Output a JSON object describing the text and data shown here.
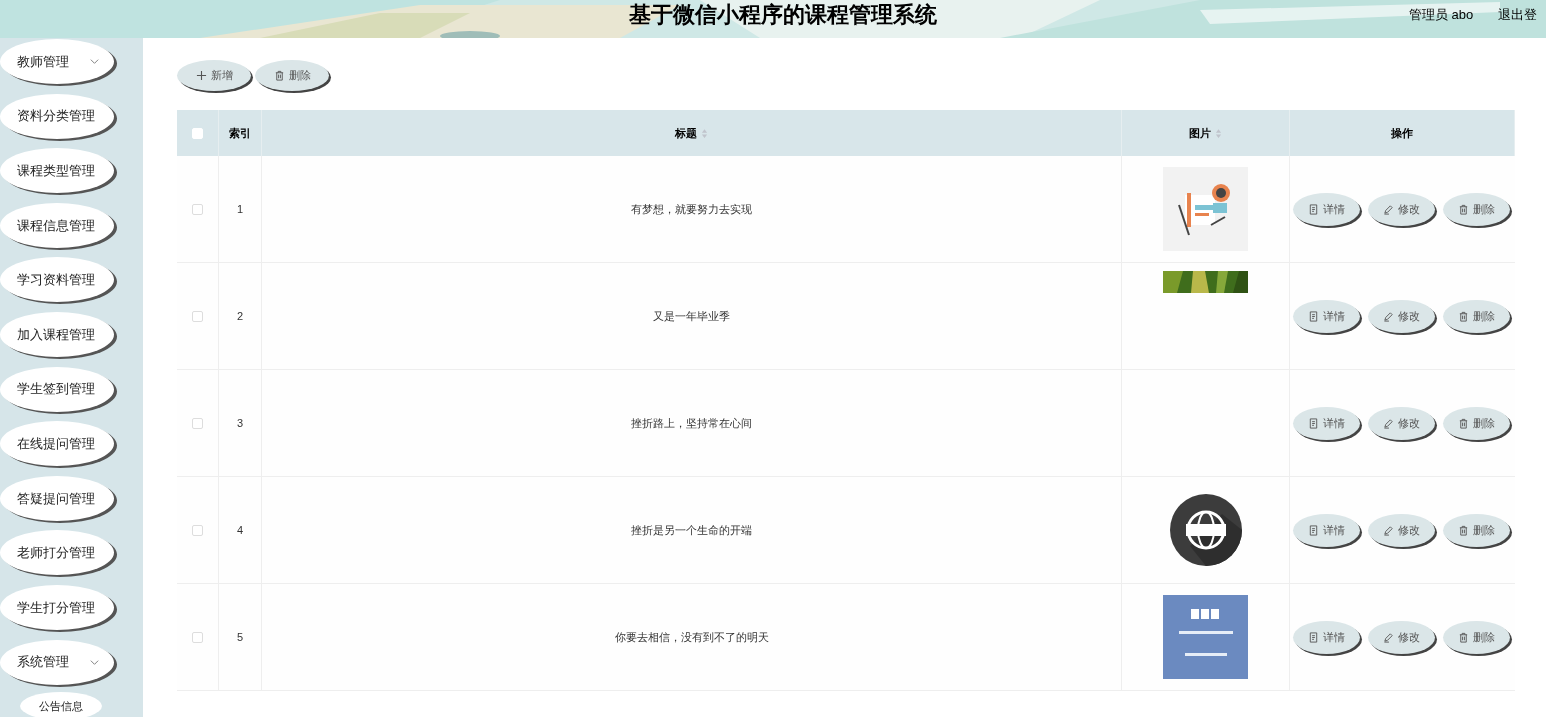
{
  "header": {
    "title": "基于微信小程序的课程管理系统",
    "user": "管理员 abo",
    "logout": "退出登"
  },
  "sidebar": {
    "items": [
      {
        "label": "教师管理",
        "kind": "group"
      },
      {
        "label": "资料分类管理",
        "kind": "link"
      },
      {
        "label": "课程类型管理",
        "kind": "link"
      },
      {
        "label": "课程信息管理",
        "kind": "link"
      },
      {
        "label": "学习资料管理",
        "kind": "link"
      },
      {
        "label": "加入课程管理",
        "kind": "link"
      },
      {
        "label": "学生签到管理",
        "kind": "link"
      },
      {
        "label": "在线提问管理",
        "kind": "link"
      },
      {
        "label": "答疑提问管理",
        "kind": "link"
      },
      {
        "label": "老师打分管理",
        "kind": "link"
      },
      {
        "label": "学生打分管理",
        "kind": "link"
      },
      {
        "label": "系统管理",
        "kind": "group",
        "children": [
          {
            "label": "公告信息"
          }
        ]
      }
    ]
  },
  "toolbar": [
    {
      "label": "新增",
      "kind": "add"
    },
    {
      "label": "删除",
      "kind": "delete"
    }
  ],
  "table": {
    "header_checkbox": {
      "checked": false
    },
    "columns": [
      {
        "label": "索引",
        "sortable": false
      },
      {
        "label": "标题",
        "sortable": true
      },
      {
        "label": "图片",
        "sortable": true
      },
      {
        "label": "操作",
        "sortable": false
      }
    ],
    "rows": [
      {
        "checked": false,
        "index": "1",
        "title": "有梦想，就要努力去实现",
        "image": {
          "kind": "picture"
        },
        "actions": [
          {
            "label": "详情",
            "kind": "detail"
          },
          {
            "label": "修改",
            "kind": "edit"
          },
          {
            "label": "删除",
            "kind": "delete"
          }
        ]
      },
      {
        "checked": false,
        "index": "2",
        "title": "又是一年毕业季",
        "image": {
          "kind": "picture"
        },
        "actions": [
          {
            "label": "详情",
            "kind": "detail"
          },
          {
            "label": "修改",
            "kind": "edit"
          },
          {
            "label": "删除",
            "kind": "delete"
          }
        ]
      },
      {
        "checked": false,
        "index": "3",
        "title": "挫折路上，坚持常在心间",
        "actions": [
          {
            "label": "详情",
            "kind": "detail"
          },
          {
            "label": "修改",
            "kind": "edit"
          },
          {
            "label": "删除",
            "kind": "delete"
          }
        ]
      },
      {
        "checked": false,
        "index": "4",
        "title": "挫折是另一个生命的开端",
        "image": {
          "kind": "picture"
        },
        "actions": [
          {
            "label": "详情",
            "kind": "detail"
          },
          {
            "label": "修改",
            "kind": "edit"
          },
          {
            "label": "删除",
            "kind": "delete"
          }
        ]
      },
      {
        "checked": false,
        "index": "5",
        "title": "你要去相信，没有到不了的明天",
        "image": {
          "kind": "picture"
        },
        "actions": [
          {
            "label": "详情",
            "kind": "detail"
          },
          {
            "label": "修改",
            "kind": "edit"
          },
          {
            "label": "删除",
            "kind": "delete"
          }
        ]
      }
    ]
  }
}
